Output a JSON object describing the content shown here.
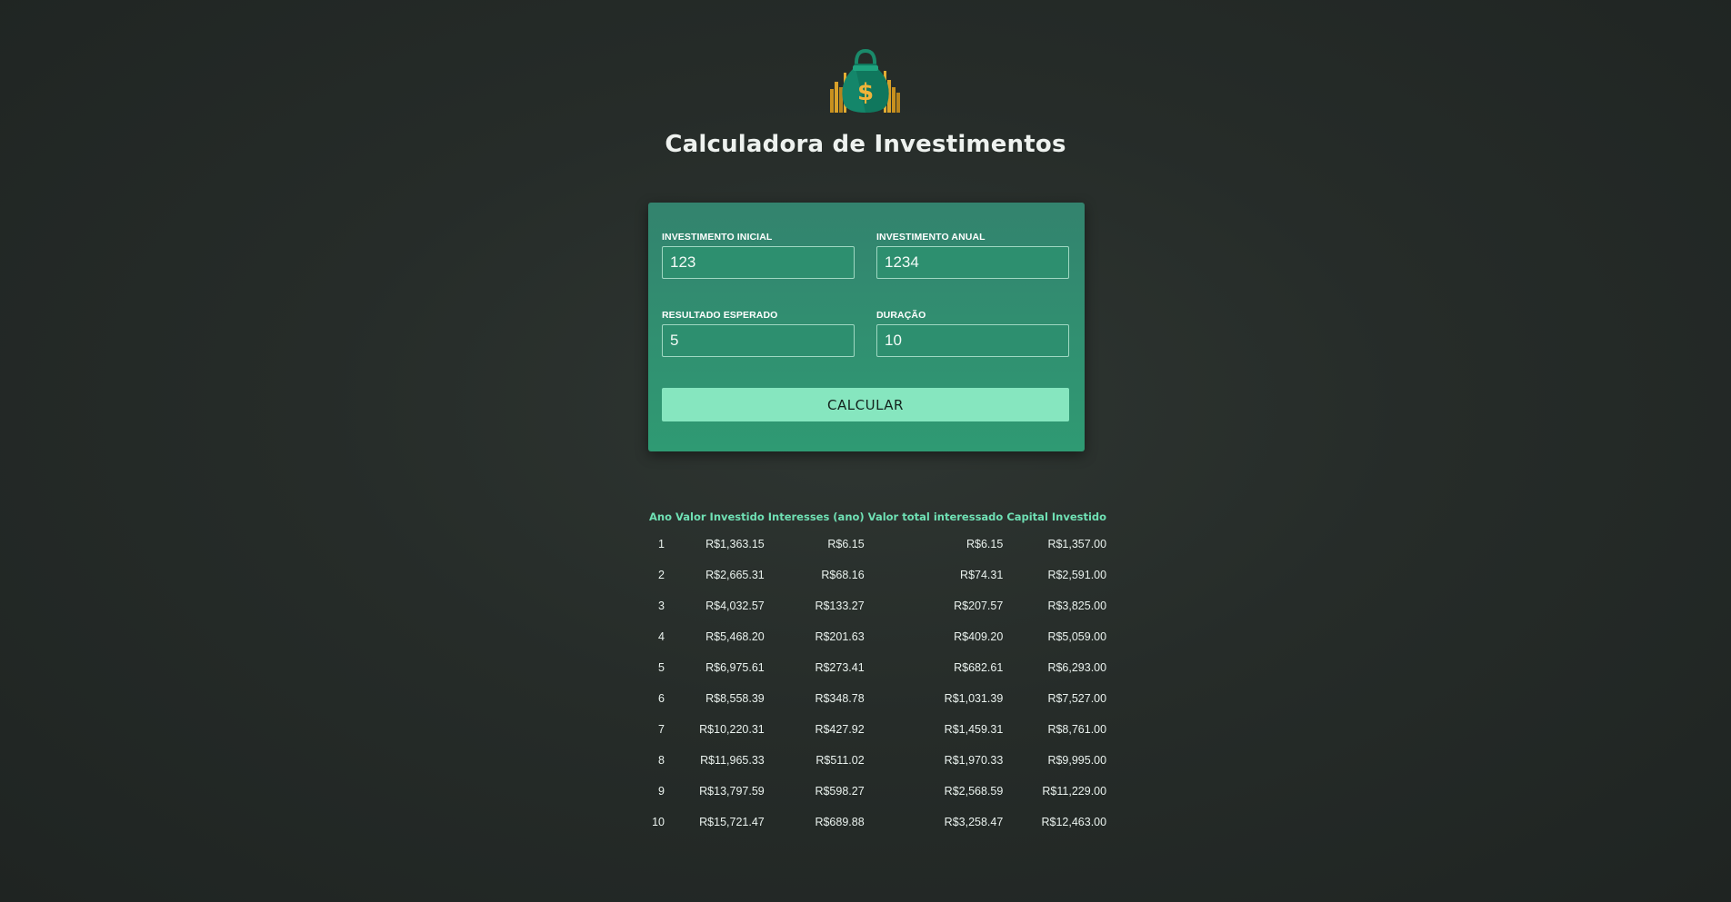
{
  "header": {
    "title": "Calculadora de Investimentos",
    "logo_icon": "money-bag-dollar-icon"
  },
  "form": {
    "initial_label": "INVESTIMENTO INICIAL",
    "initial_value": "123",
    "annual_label": "INVESTIMENTO ANUAL",
    "annual_value": "1234",
    "expected_label": "RESULTADO ESPERADO",
    "expected_value": "5",
    "duration_label": "DURAÇÃO",
    "duration_value": "10",
    "submit_label": "CALCULAR"
  },
  "colors": {
    "card_green": "#2f9a73",
    "button_mint": "#86e6bf",
    "header_mint": "#6fe0b4",
    "background": "#262c29"
  },
  "table": {
    "headers": [
      "Ano",
      "Valor Investido",
      "Interesses (ano)",
      "Valor total interessado",
      "Capital Investido"
    ],
    "rows": [
      [
        "1",
        "R$1,363.15",
        "R$6.15",
        "R$6.15",
        "R$1,357.00"
      ],
      [
        "2",
        "R$2,665.31",
        "R$68.16",
        "R$74.31",
        "R$2,591.00"
      ],
      [
        "3",
        "R$4,032.57",
        "R$133.27",
        "R$207.57",
        "R$3,825.00"
      ],
      [
        "4",
        "R$5,468.20",
        "R$201.63",
        "R$409.20",
        "R$5,059.00"
      ],
      [
        "5",
        "R$6,975.61",
        "R$273.41",
        "R$682.61",
        "R$6,293.00"
      ],
      [
        "6",
        "R$8,558.39",
        "R$348.78",
        "R$1,031.39",
        "R$7,527.00"
      ],
      [
        "7",
        "R$10,220.31",
        "R$427.92",
        "R$1,459.31",
        "R$8,761.00"
      ],
      [
        "8",
        "R$11,965.33",
        "R$511.02",
        "R$1,970.33",
        "R$9,995.00"
      ],
      [
        "9",
        "R$13,797.59",
        "R$598.27",
        "R$2,568.59",
        "R$11,229.00"
      ],
      [
        "10",
        "R$15,721.47",
        "R$689.88",
        "R$3,258.47",
        "R$12,463.00"
      ]
    ]
  }
}
